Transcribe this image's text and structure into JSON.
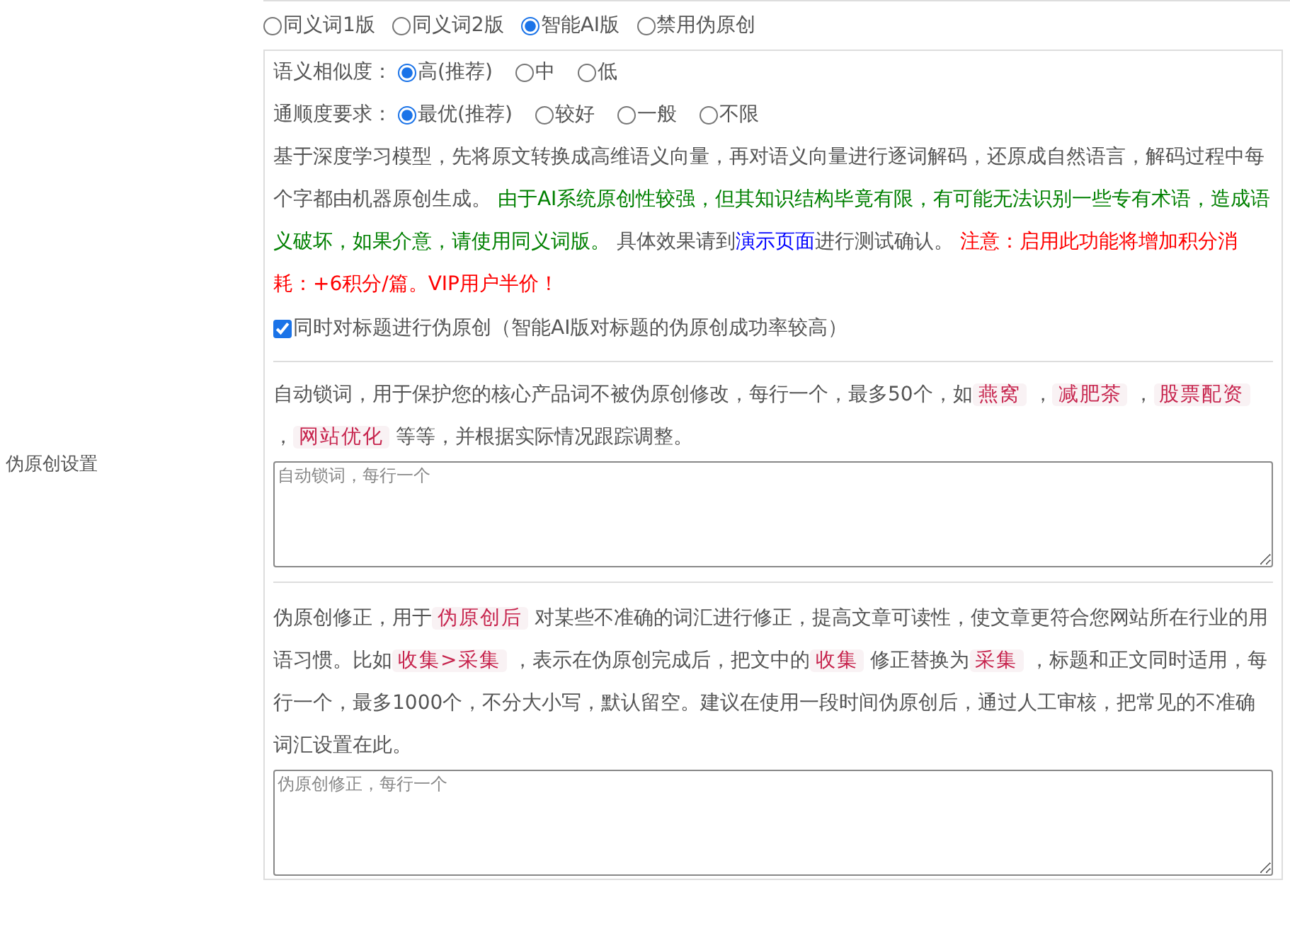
{
  "section_label": "伪原创设置",
  "mode_options": [
    {
      "label": "同义词1版",
      "selected": false
    },
    {
      "label": "同义词2版",
      "selected": false
    },
    {
      "label": "智能AI版",
      "selected": true
    },
    {
      "label": "禁用伪原创",
      "selected": false
    }
  ],
  "similarity": {
    "label": "语义相似度：",
    "options": [
      {
        "label": "高(推荐)",
        "selected": true
      },
      {
        "label": "中",
        "selected": false
      },
      {
        "label": "低",
        "selected": false
      }
    ]
  },
  "fluency": {
    "label": "通顺度要求：",
    "options": [
      {
        "label": "最优(推荐)",
        "selected": true
      },
      {
        "label": "较好",
        "selected": false
      },
      {
        "label": "一般",
        "selected": false
      },
      {
        "label": "不限",
        "selected": false
      }
    ]
  },
  "ai_description": [
    {
      "kind": "plain",
      "text": "基于深度学习模型，先将原文转换成高维语义向量，再对语义向量进行逐词解码，还原成自然语言，解码过程中每个字都由机器原创生成。 "
    },
    {
      "kind": "green",
      "text": "由于AI系统原创性较强，但其知识结构毕竟有限，有可能无法识别一些专有术语，造成语义破坏，如果介意，请使用同义词版。"
    },
    {
      "kind": "plain",
      "text": " 具体效果请到"
    },
    {
      "kind": "link",
      "text": "演示页面"
    },
    {
      "kind": "plain",
      "text": "进行测试确认。 "
    },
    {
      "kind": "red",
      "text": "注意：启用此功能将增加积分消耗：+6积分/篇。VIP用户半价！"
    }
  ],
  "title_option": {
    "label": "同时对标题进行伪原创（智能AI版对标题的伪原创成功率较高）",
    "checked": true
  },
  "lock_words": {
    "description": [
      {
        "kind": "plain",
        "text": "自动锁词，用于保护您的核心产品词不被伪原创修改，每行一个，最多50个，如"
      },
      {
        "kind": "tag",
        "text": "燕窝"
      },
      {
        "kind": "plain",
        "text": " ，"
      },
      {
        "kind": "tag",
        "text": "减肥茶"
      },
      {
        "kind": "plain",
        "text": " ，"
      },
      {
        "kind": "tag",
        "text": "股票配资"
      },
      {
        "kind": "plain",
        "text": " ，"
      },
      {
        "kind": "tag",
        "text": "网站优化"
      },
      {
        "kind": "plain",
        "text": " 等等，并根据实际情况跟踪调整。"
      }
    ],
    "placeholder": "自动锁词，每行一个"
  },
  "correction": {
    "description": [
      {
        "kind": "plain",
        "text": "伪原创修正，用于"
      },
      {
        "kind": "tag",
        "text": "伪原创后"
      },
      {
        "kind": "plain",
        "text": " 对某些不准确的词汇进行修正，提高文章可读性，使文章更符合您网站所在行业的用语习惯。比如"
      },
      {
        "kind": "tag",
        "text": "收集>采集"
      },
      {
        "kind": "plain",
        "text": " ，表示在伪原创完成后，把文中的"
      },
      {
        "kind": "tag",
        "text": "收集"
      },
      {
        "kind": "plain",
        "text": " 修正替换为"
      },
      {
        "kind": "tag",
        "text": "采集"
      },
      {
        "kind": "plain",
        "text": " ，标题和正文同时适用，每行一个，最多1000个，不分大小写，默认留空。建议在使用一段时间伪原创后，通过人工审核，把常见的不准确词汇设置在此。"
      }
    ],
    "placeholder": "伪原创修正，每行一个"
  }
}
